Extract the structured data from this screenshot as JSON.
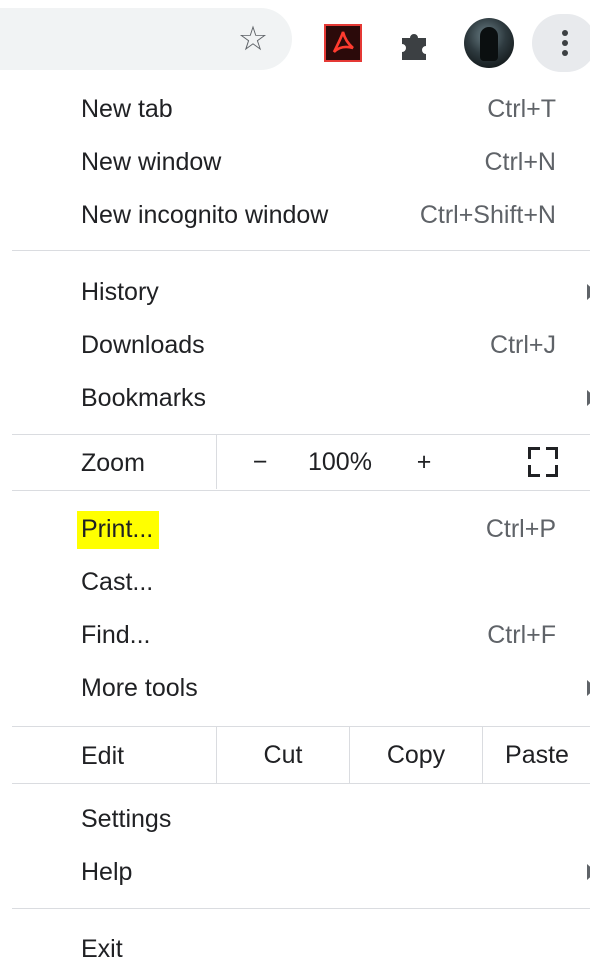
{
  "toolbar": {
    "icons": [
      "star-icon",
      "acrobat-extension-icon",
      "extensions-puzzle-icon",
      "profile-avatar",
      "more-vert-icon"
    ],
    "star_glyph": "☆",
    "accent": "#e53935"
  },
  "menu": {
    "new_tab": {
      "label": "New tab",
      "shortcut": "Ctrl+T"
    },
    "new_window": {
      "label": "New window",
      "shortcut": "Ctrl+N"
    },
    "new_incognito": {
      "label": "New incognito window",
      "shortcut": "Ctrl+Shift+N"
    },
    "history": {
      "label": "History"
    },
    "downloads": {
      "label": "Downloads",
      "shortcut": "Ctrl+J"
    },
    "bookmarks": {
      "label": "Bookmarks"
    },
    "zoom": {
      "label": "Zoom",
      "minus": "−",
      "value": "100%",
      "plus": "+"
    },
    "print": {
      "label": "Print...",
      "shortcut": "Ctrl+P",
      "highlight": "#ffff00"
    },
    "cast": {
      "label": "Cast..."
    },
    "find": {
      "label": "Find...",
      "shortcut": "Ctrl+F"
    },
    "more_tools": {
      "label": "More tools"
    },
    "edit": {
      "label": "Edit",
      "cut": "Cut",
      "copy": "Copy",
      "paste": "Paste"
    },
    "settings": {
      "label": "Settings"
    },
    "help": {
      "label": "Help"
    },
    "exit": {
      "label": "Exit"
    }
  }
}
